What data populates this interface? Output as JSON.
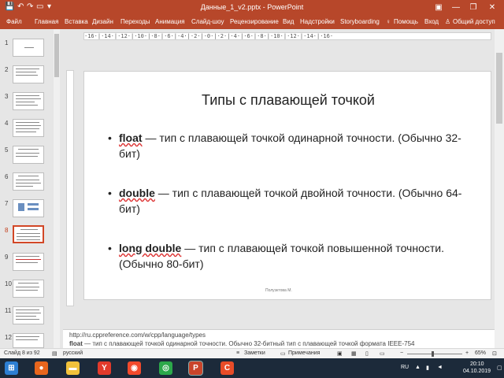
{
  "titlebar": {
    "title": "Данные_1_v2.pptx - PowerPoint",
    "minimize": "—",
    "restore": "❐",
    "close": "✕",
    "ribbon_display": "▣"
  },
  "quick_access": {
    "save": "💾",
    "undo": "↶",
    "redo": "↷",
    "present": "▭",
    "customize": "▾"
  },
  "ribbon": {
    "tabs": [
      "Файл",
      "Главная",
      "Вставка",
      "Дизайн",
      "Переходы",
      "Анимация",
      "Слайд-шоу",
      "Рецензирование",
      "Вид",
      "Надстройки",
      "Storyboarding",
      "Помощь",
      "Вход",
      "Общий доступ"
    ]
  },
  "ruler": {
    "horizontal": "·16·|·14·|·12·|·10·|·8·|·6·|·4·|·2·|·0·|·2·|·4·|·6·|·8·|·10·|·12·|·14·|·16·"
  },
  "thumbnails": {
    "numbers": [
      "1",
      "2",
      "3",
      "4",
      "5",
      "6",
      "7",
      "8",
      "9",
      "10",
      "11",
      "12"
    ],
    "selected": "8"
  },
  "slide": {
    "title": "Типы с плавающей точкой",
    "bullet_char": "•",
    "bullets": [
      {
        "keyword": "float",
        "rest": " — тип с плавающей точкой одинарной точности. (Обычно 32-бит)"
      },
      {
        "keyword": "double",
        "rest": " — тип с плавающей точкой двойной точности. (Обычно 64-бит)"
      },
      {
        "keyword": "long double",
        "rest": " — тип с плавающей точкой повышенной точности. (Обычно 80-бит)"
      }
    ],
    "footer": "Полуэктова М."
  },
  "notes": {
    "line1": "http://ru.cppreference.com/w/cpp/language/types",
    "line2_bold": "float",
    "line2_rest": " — тип с плавающей точкой одинарной точности. Обычно 32-битный тип с плавающей точкой формата IEEE-754"
  },
  "status": {
    "slide": "Слайд 8 из 92",
    "language": "русский",
    "notes": "Заметки",
    "comments": "Примечания",
    "zoom_minus": "−",
    "zoom_plus": "+",
    "zoom_level": "65%",
    "zoom_fraction": 0.45
  },
  "taskbar": {
    "icons": [
      {
        "name": "windows",
        "glyph": "⊞",
        "color": "#2d7fd3"
      },
      {
        "name": "firefox",
        "glyph": "●",
        "color": "#e8661d"
      },
      {
        "name": "explorer",
        "glyph": "▬",
        "color": "#f2c23b"
      },
      {
        "name": "yandex",
        "glyph": "Y",
        "color": "#e23a2b"
      },
      {
        "name": "yandex-browser",
        "glyph": "◉",
        "color": "#f24a2c"
      },
      {
        "name": "chrome",
        "glyph": "◎",
        "color": "#2ca84a"
      },
      {
        "name": "powerpoint",
        "glyph": "P",
        "color": "#c9452b"
      },
      {
        "name": "screencast",
        "glyph": "C",
        "color": "#e84c28"
      }
    ],
    "tray": {
      "lang": "RU",
      "time": "20:10",
      "date": "04.10.2019"
    }
  }
}
